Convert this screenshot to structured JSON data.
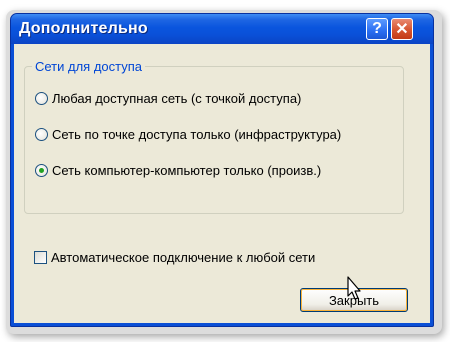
{
  "window": {
    "title": "Дополнительно",
    "help_label": "?",
    "close_label": "✕"
  },
  "group": {
    "legend": "Сети для доступа",
    "options": [
      {
        "label": "Любая доступная сеть (с точкой доступа)",
        "selected": false
      },
      {
        "label": "Сеть по точке доступа только (инфраструктура)",
        "selected": false
      },
      {
        "label": "Сеть компьютер-компьютер только (произв.)",
        "selected": true
      }
    ]
  },
  "auto_connect": {
    "label": "Автоматическое подключение к любой сети",
    "checked": false
  },
  "buttons": {
    "close_label": "Закрыть"
  },
  "colors": {
    "titlebar": "#0a55de",
    "dialog_bg": "#ece9d8",
    "legend_text": "#0046d5",
    "radio_selected": "#21a121",
    "close_button_red": "#d6542f"
  },
  "icons": [
    "help-icon",
    "close-icon",
    "mouse-cursor-icon"
  ]
}
